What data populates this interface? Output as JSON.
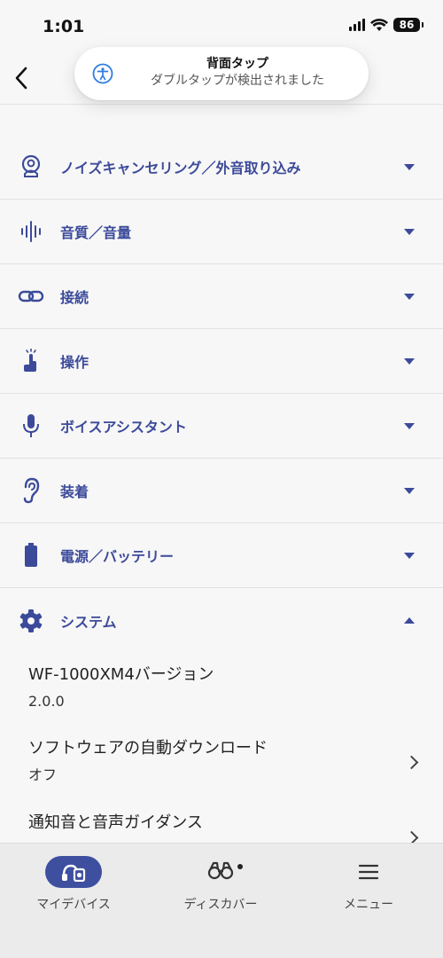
{
  "status_bar": {
    "time": "1:01",
    "battery": "86"
  },
  "toast": {
    "title": "背面タップ",
    "subtitle": "ダブルタップが検出されました"
  },
  "sections": [
    {
      "label": "ノイズキャンセリング／外音取り込み",
      "icon": "person-head-icon",
      "expanded": false
    },
    {
      "label": "音質／音量",
      "icon": "sound-wave-icon",
      "expanded": false
    },
    {
      "label": "接続",
      "icon": "link-icon",
      "expanded": false
    },
    {
      "label": "操作",
      "icon": "tap-finger-icon",
      "expanded": false
    },
    {
      "label": "ボイスアシスタント",
      "icon": "microphone-icon",
      "expanded": false
    },
    {
      "label": "装着",
      "icon": "ear-icon",
      "expanded": false
    },
    {
      "label": "電源／バッテリー",
      "icon": "battery-icon",
      "expanded": false
    },
    {
      "label": "システム",
      "icon": "gear-icon",
      "expanded": true
    }
  ],
  "system_items": [
    {
      "title": "WF-1000XM4バージョン",
      "value": "2.0.0"
    },
    {
      "title": "ソフトウェアの自動ダウンロード",
      "value": "オフ"
    },
    {
      "title": "通知音と音声ガイダンス",
      "value": ""
    }
  ],
  "tabs": [
    {
      "label": "マイデバイス",
      "icon": "headphones-icon",
      "active": true
    },
    {
      "label": "ディスカバー",
      "icon": "binoculars-icon",
      "active": false
    },
    {
      "label": "メニュー",
      "icon": "menu-icon",
      "active": false
    }
  ],
  "colors": {
    "accent": "#3c4a9a",
    "tab_active": "#3e4fa0",
    "background": "#f7f7f7"
  }
}
